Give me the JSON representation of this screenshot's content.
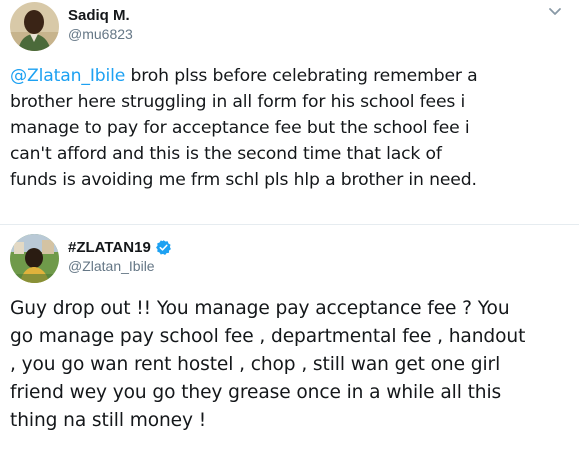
{
  "tweets": [
    {
      "author": {
        "name": "Sadiq M.",
        "handle": "@mu6823",
        "verified": false,
        "avatar_icon": "user-photo-avatar"
      },
      "mention": "@Zlatan_Ibile",
      "lines": [
        " broh plss before celebrating remember a",
        "brother here struggling in all form for his school fees i",
        "manage to pay for acceptance fee but the school fee i",
        "can't afford and this is the second time that lack of",
        "funds is avoiding me frm schl pls hlp a brother in need."
      ]
    },
    {
      "author": {
        "name": "#ZLATAN19",
        "handle": "@Zlatan_Ibile",
        "verified": true,
        "avatar_icon": "user-photo-avatar"
      },
      "lines": [
        "Guy drop out !! You manage pay acceptance fee ? You",
        "go manage pay school fee , departmental fee , handout",
        ", you go wan rent hostel , chop , still wan get one girl",
        "friend wey you go they grease once in a while all this",
        "thing na still money !"
      ]
    }
  ],
  "colors": {
    "text": "#14171a",
    "secondary": "#657786",
    "link": "#1da1f2",
    "verified": "#1da1f2",
    "divider": "#e6ecf0"
  },
  "icons": {
    "menu": "chevron-down-icon",
    "verified": "verified-badge-icon"
  }
}
